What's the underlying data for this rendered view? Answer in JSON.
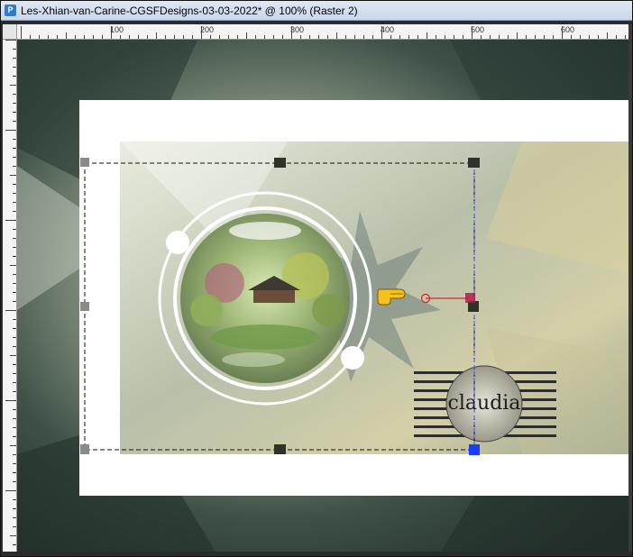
{
  "window": {
    "title": "Les-Xhian-van-Carine-CGSFDesigns-03-03-2022* @ 100% (Raster 2)",
    "app_icon_glyph": "P"
  },
  "ruler": {
    "labels": [
      "100",
      "200",
      "300",
      "400",
      "500",
      "600"
    ]
  },
  "watermark": {
    "text": "claudia"
  },
  "icons": {
    "pointer": "pointing-hand-icon",
    "rotation_handle": "rotation-handle-icon"
  },
  "colors": {
    "title_bg": "#d6e2f1",
    "selection_handle": "#2f3228",
    "anchor": "#1a3cff",
    "rotation_line": "#d62828"
  }
}
